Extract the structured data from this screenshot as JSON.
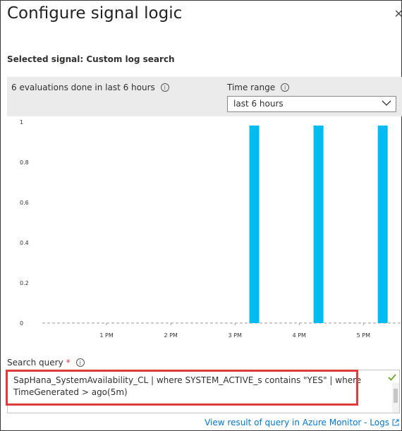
{
  "title": "Configure signal logic",
  "selected_signal": "Selected signal: Custom log search",
  "evaluations_text": "6 evaluations done in last 6 hours",
  "time_range": {
    "label": "Time range",
    "selected": "last 6 hours"
  },
  "search_query": {
    "label": "Search query",
    "required_marker": "*",
    "value": "SapHana_SystemAvailability_CL | where SYSTEM_ACTIVE_s contains \"YES\" | where TimeGenerated > ago(5m)"
  },
  "link": "View result of query in Azure Monitor - Logs",
  "colors": {
    "bar": "#00bcf2",
    "highlight": "#e03c3c",
    "link": "#0078d4"
  },
  "chart_data": {
    "type": "bar",
    "y_ticks": [
      "0",
      "0.2",
      "0.4",
      "0.6",
      "0.8",
      "1"
    ],
    "ylim": [
      0,
      1
    ],
    "x_ticks": [
      {
        "label": "1 PM",
        "pos": 1
      },
      {
        "label": "2 PM",
        "pos": 2
      },
      {
        "label": "3 PM",
        "pos": 3
      },
      {
        "label": "4 PM",
        "pos": 4
      },
      {
        "label": "5 PM",
        "pos": 5
      }
    ],
    "xlim": [
      0.0,
      5.6
    ],
    "bars": [
      {
        "x": 3.3,
        "value": 1
      },
      {
        "x": 4.3,
        "value": 1
      },
      {
        "x": 5.3,
        "value": 1
      }
    ]
  }
}
